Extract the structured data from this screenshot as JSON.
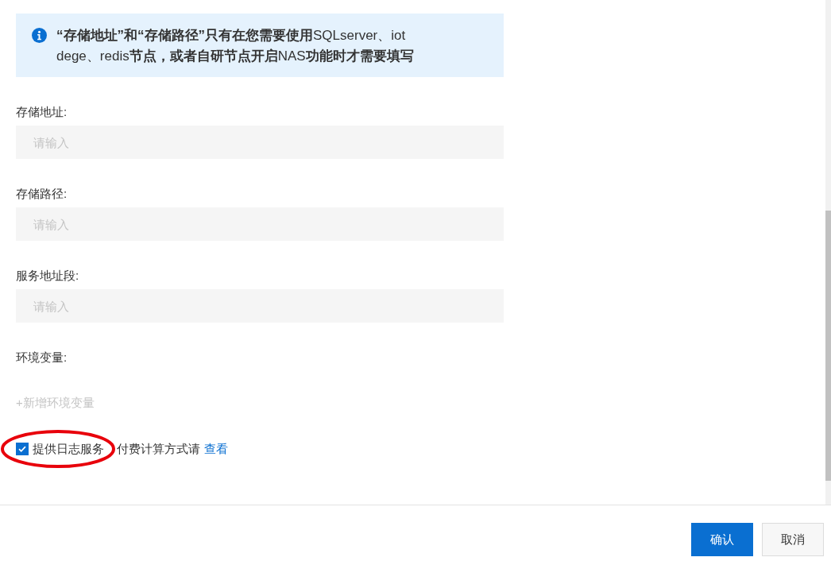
{
  "notice": {
    "text": "**“存储地址”和“存储路径”只有在您需要使用**SQLserver、iot dege、redis**节点，或者自研节点开启**NAS**功能时才需要填写**"
  },
  "fields": [
    {
      "label": "存储地址:",
      "placeholder": "请输入"
    },
    {
      "label": "存储路径:",
      "placeholder": "请输入"
    },
    {
      "label": "服务地址段:",
      "placeholder": "请输入"
    }
  ],
  "env": {
    "label": "环境变量:",
    "add_link": "+新增环境变量",
    "disabled": true
  },
  "log_service": {
    "label": "提供日志服务",
    "checked": true,
    "note": "付费计算方式请",
    "link": "查看"
  },
  "annotation": {
    "kind": "ellipse",
    "color": "#e8000b"
  },
  "buttons": [
    {
      "label": "确认",
      "kind": "primary"
    },
    {
      "label": "取消",
      "kind": "secondary"
    }
  ]
}
